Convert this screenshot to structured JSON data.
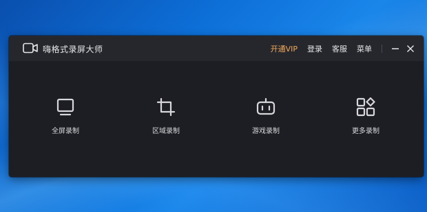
{
  "app": {
    "title": "嗨格式录屏大师"
  },
  "menu": {
    "vip": "开通VIP",
    "login": "登录",
    "service": "客服",
    "menu": "菜单"
  },
  "features": [
    {
      "label": "全屏录制",
      "icon": "monitor-icon"
    },
    {
      "label": "区域录制",
      "icon": "crop-icon"
    },
    {
      "label": "游戏录制",
      "icon": "gamepad-icon"
    },
    {
      "label": "更多录制",
      "icon": "apps-icon"
    }
  ],
  "colors": {
    "accent_vip": "#f3a95c",
    "window_bg": "#1d1e23",
    "titlebar_bg": "#26272d"
  }
}
